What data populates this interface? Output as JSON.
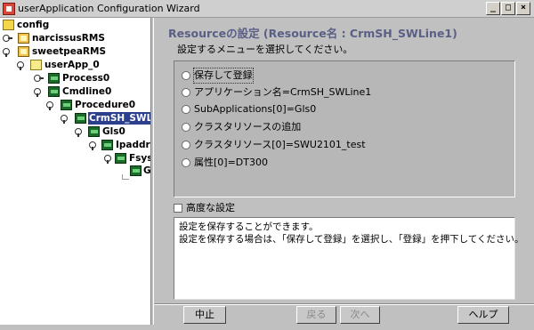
{
  "window": {
    "title": "userApplication Configuration Wizard",
    "min_label": "_",
    "max_label": "□",
    "close_label": "×"
  },
  "tree": {
    "nodes": [
      {
        "label": "config"
      },
      {
        "label": "narcissusRMS"
      },
      {
        "label": "sweetpeaRMS"
      },
      {
        "label": "userApp_0"
      },
      {
        "label": "Process0"
      },
      {
        "label": "Cmdline0"
      },
      {
        "label": "Procedure0"
      },
      {
        "label": "CrmSH_SWLine"
      },
      {
        "label": "Gls0"
      },
      {
        "label": "Ipaddress"
      },
      {
        "label": "Fsyste"
      },
      {
        "label": "Gd"
      }
    ]
  },
  "panel": {
    "heading": "Resourceの設定 (Resource名 : CrmSH_SWLine1)",
    "instruction": "設定するメニューを選択してください。",
    "options": [
      {
        "label": "保存して登録"
      },
      {
        "label": "アプリケーション名=CrmSH_SWLine1"
      },
      {
        "label": "SubApplications[0]=Gls0"
      },
      {
        "label": "クラスタリソースの追加"
      },
      {
        "label": "クラスタリソース[0]=SWU2101_test"
      },
      {
        "label": "属性[0]=DT300"
      }
    ],
    "advanced_label": "高度な設定",
    "description": {
      "line1": "設定を保存することができます。",
      "line2": "設定を保存する場合は、「保存して登録」を選択し、「登録」を押下してください。"
    },
    "buttons": {
      "stop": "中止",
      "back": "戻る",
      "next": "次へ",
      "help": "ヘルプ"
    }
  }
}
